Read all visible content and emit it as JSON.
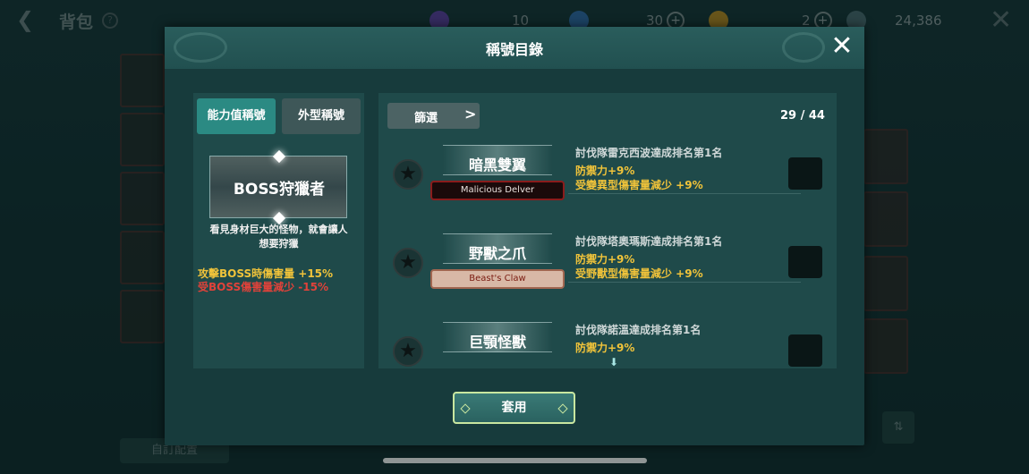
{
  "background": {
    "title": "背包",
    "help_icon": "?",
    "currencies": [
      {
        "icon": "purple-orb-icon",
        "value": "10",
        "color": "#5b3fa0"
      },
      {
        "icon": "blue-orb-icon",
        "value": "30",
        "color": "#2f6aa8",
        "plus": "+"
      },
      {
        "icon": "gold-coin-icon",
        "value": "2",
        "color": "#b88b20",
        "plus": "+"
      },
      {
        "icon": "gem-icon",
        "value": "24,386",
        "color": "#4a6a70"
      }
    ],
    "close_icon": "✕",
    "back_icon": "❮",
    "bottom_button": "自訂配置"
  },
  "dialog": {
    "title": "稱號目錄",
    "close_icon": "✕",
    "tabs": {
      "active": "能力值稱號",
      "inactive": "外型稱號"
    },
    "selected": {
      "title": "BOSS狩獵者",
      "desc_line1": "看見身材巨大的怪物，就會讓人",
      "desc_line2": "想要狩獵",
      "effect1": "攻擊BOSS時傷害量 +15%",
      "effect2": "受BOSS傷害量減少 -15%"
    },
    "filter": {
      "label": "篩選",
      "chevron": ">"
    },
    "count": "29 / 44",
    "rows": [
      {
        "name": "暗黑雙翼",
        "badge": "Malicious Delver",
        "requirement": "討伐隊雷克西波達成排名第1名",
        "effect1": "防禦力+9%",
        "effect2": "受變異型傷害量減少 +9%"
      },
      {
        "name": "野獸之爪",
        "badge": "Beast's Claw",
        "requirement": "討伐隊塔奧瑪斯達成排名第1名",
        "effect1": "防禦力+9%",
        "effect2": "受野獸型傷害量減少 +9%"
      },
      {
        "name": "巨顎怪獸",
        "requirement": "討伐隊諾溫達成排名第1名",
        "effect1": "防禦力+9%"
      }
    ],
    "star_icon": "★",
    "scroll_icon": "⬇",
    "apply": "套用"
  }
}
